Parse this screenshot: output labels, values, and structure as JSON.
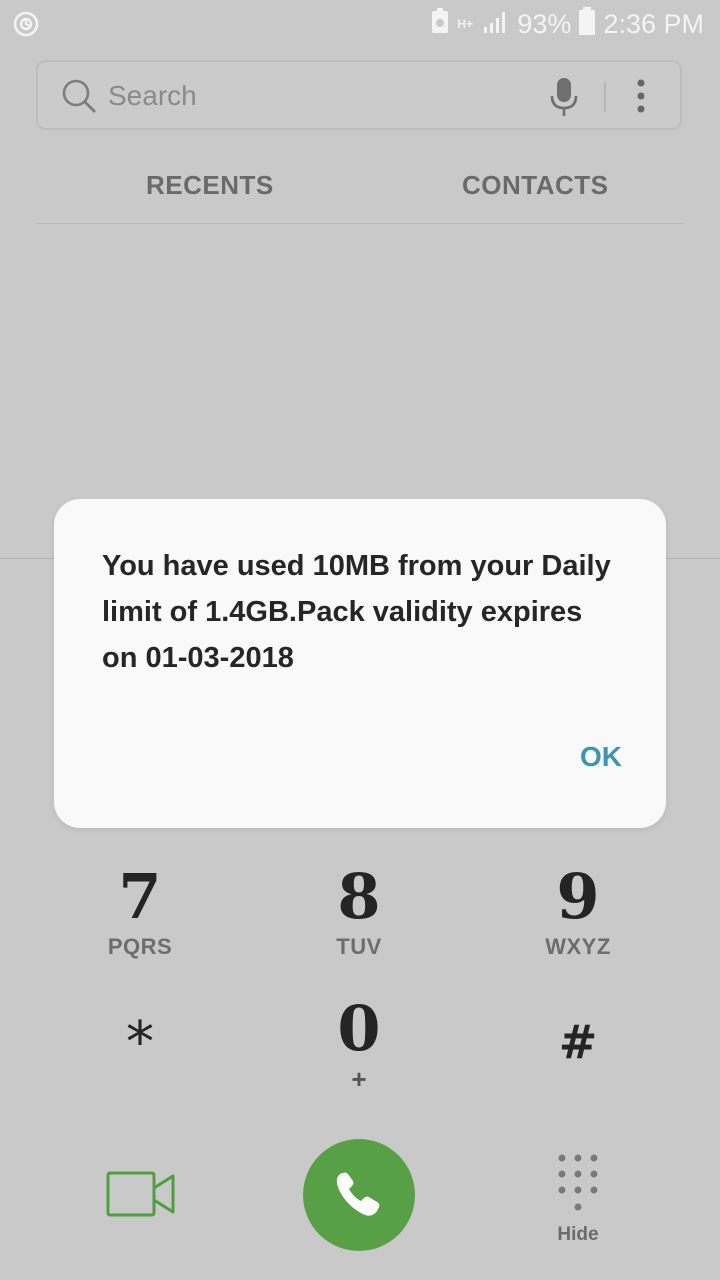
{
  "status_bar": {
    "network": "H+",
    "battery": "93%",
    "time": "2:36 PM"
  },
  "search": {
    "placeholder": "Search"
  },
  "tabs": [
    {
      "label": "RECENTS"
    },
    {
      "label": "CONTACTS"
    }
  ],
  "dialog": {
    "message": "You have used 10MB from your Daily limit of 1.4GB.Pack validity expires on 01-03-2018",
    "ok_label": "OK"
  },
  "keypad": {
    "keys": [
      {
        "digit": "7",
        "letters": "PQRS"
      },
      {
        "digit": "8",
        "letters": "TUV"
      },
      {
        "digit": "9",
        "letters": "WXYZ"
      },
      {
        "digit": "*",
        "letters": ""
      },
      {
        "digit": "0",
        "letters": "+"
      },
      {
        "digit": "#",
        "letters": ""
      }
    ]
  },
  "bottom": {
    "hide_label": "Hide"
  },
  "colors": {
    "call_green": "#58a046",
    "video_green": "#4f9e3f",
    "ok_blue": "#3f93b3"
  },
  "icons": [
    "sync-icon",
    "battery-saver-icon",
    "signal-icon",
    "battery-icon",
    "search-icon",
    "mic-icon",
    "more-vert-icon",
    "video-call-icon",
    "phone-icon",
    "keypad-icon"
  ]
}
